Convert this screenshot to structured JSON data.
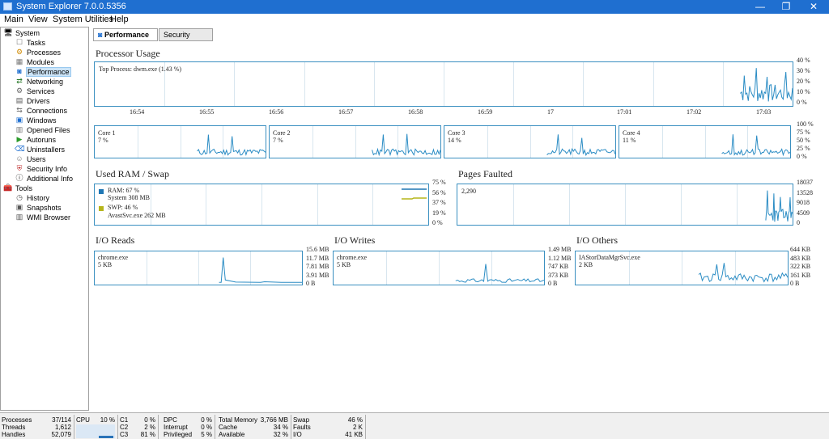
{
  "window": {
    "title": "System Explorer 7.0.0.5356",
    "minimize_icon": "—",
    "restore_icon": "❐",
    "close_icon": "✕"
  },
  "menu": [
    "Main",
    "View",
    "System Utilities",
    "Help"
  ],
  "sidebar": {
    "system_label": "System",
    "system_items": [
      "Tasks",
      "Processes",
      "Modules",
      "Performance",
      "Networking",
      "Services",
      "Drivers",
      "Connections",
      "Windows",
      "Opened Files",
      "Autoruns",
      "Uninstallers",
      "Users",
      "Security Info",
      "Additional Info"
    ],
    "tools_label": "Tools",
    "tools_items": [
      "History",
      "Snapshots",
      "WMI Browser"
    ],
    "selected": "Performance"
  },
  "tabs": {
    "performance": "Performance",
    "security_scan": "Security Scan"
  },
  "processor": {
    "title": "Processor Usage",
    "top_process": "Top Process: dwm.exe (1.43 %)",
    "y_ticks": [
      "40 %",
      "30 %",
      "20 %",
      "10 %",
      "0 %"
    ],
    "x_ticks": [
      "16:54",
      "16:55",
      "16:56",
      "16:57",
      "16:58",
      "16:59",
      "17",
      "17:01",
      "17:02",
      "17:03"
    ]
  },
  "cores": {
    "items": [
      {
        "name": "Core 1",
        "value": "7 %"
      },
      {
        "name": "Core 2",
        "value": "7 %"
      },
      {
        "name": "Core 3",
        "value": "14 %"
      },
      {
        "name": "Core 4",
        "value": "11 %"
      }
    ],
    "y_ticks": [
      "100 %",
      "75 %",
      "50 %",
      "25 %",
      "0 %"
    ]
  },
  "ram": {
    "title": "Used RAM / Swap",
    "ram_label": "RAM: 67 %",
    "ram_sub": "System 308 MB",
    "swp_label": "SWP: 46 %",
    "swp_sub": "AvastSvc.exe 262 MB",
    "ram_color": "#1f77b4",
    "swp_color": "#b5b51a",
    "y_ticks": [
      "75 %",
      "56 %",
      "37 %",
      "19 %",
      "0 %"
    ]
  },
  "pages": {
    "title": "Pages Faulted",
    "value": "2,290",
    "y_ticks": [
      "18037",
      "13528",
      "9018",
      "4509",
      "0"
    ]
  },
  "io_reads": {
    "title": "I/O Reads",
    "process": "chrome.exe",
    "value": "5 KB",
    "y_ticks": [
      "15.6 MB",
      "11.7 MB",
      "7.81 MB",
      "3.91 MB",
      "0 B"
    ]
  },
  "io_writes": {
    "title": "I/O Writes",
    "process": "chrome.exe",
    "value": "5 KB",
    "y_ticks": [
      "1.49 MB",
      "1.12 MB",
      "747 KB",
      "373 KB",
      "0 B"
    ]
  },
  "io_others": {
    "title": "I/O Others",
    "process": "IAStorDataMgrSvc.exe",
    "value": "2 KB",
    "y_ticks": [
      "644 KB",
      "483 KB",
      "322 KB",
      "161 KB",
      "0 B"
    ]
  },
  "status": {
    "processes": {
      "k": "Processes",
      "v": "37/114"
    },
    "threads": {
      "k": "Threads",
      "v": "1,612"
    },
    "handles": {
      "k": "Handles",
      "v": "52,079"
    },
    "cpu": {
      "k": "CPU",
      "v": "10 %"
    },
    "c1": {
      "k": "C1",
      "v": "0 %"
    },
    "c2": {
      "k": "C2",
      "v": "2 %"
    },
    "c3": {
      "k": "C3",
      "v": "81 %"
    },
    "dpc": {
      "k": "DPC",
      "v": "0 %"
    },
    "interrupt": {
      "k": "Interrupt",
      "v": "0 %"
    },
    "privileged": {
      "k": "Privileged",
      "v": "5 %"
    },
    "total_memory": {
      "k": "Total Memory",
      "v": "3,766 MB"
    },
    "cache": {
      "k": "Cache",
      "v": "34 %"
    },
    "available": {
      "k": "Available",
      "v": "32 %"
    },
    "swap": {
      "k": "Swap",
      "v": "46 %"
    },
    "faults": {
      "k": "Faults",
      "v": "2 K"
    },
    "io": {
      "k": "I/O",
      "v": "41 KB"
    }
  }
}
